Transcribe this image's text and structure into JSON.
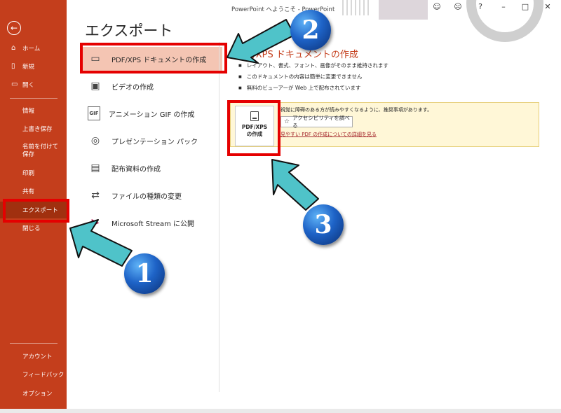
{
  "window": {
    "title": "PowerPoint へようこそ  -  PowerPoint"
  },
  "sidebar": {
    "back_icon": "back-arrow-icon",
    "top_items": [
      {
        "label": "ホーム",
        "icon": "home-icon"
      },
      {
        "label": "新規",
        "icon": "new-document-icon"
      },
      {
        "label": "開く",
        "icon": "open-folder-icon"
      }
    ],
    "mid_items": [
      {
        "label": "情報"
      },
      {
        "label": "上書き保存"
      },
      {
        "label": "名前を付けて保存"
      },
      {
        "label": "印刷"
      },
      {
        "label": "共有"
      },
      {
        "label": "エクスポート",
        "active": true
      },
      {
        "label": "閉じる"
      }
    ],
    "bottom_items": [
      {
        "label": "アカウント"
      },
      {
        "label": "フィードバック"
      },
      {
        "label": "オプション"
      }
    ]
  },
  "main": {
    "title": "エクスポート",
    "options": [
      {
        "label": "PDF/XPS ドキュメントの作成",
        "icon": "pdf-document-icon",
        "selected": true
      },
      {
        "label": "ビデオの作成",
        "icon": "video-icon"
      },
      {
        "label": "アニメーション GIF の作成",
        "icon": "gif-icon"
      },
      {
        "label": "プレゼンテーション パック",
        "icon": "package-icon"
      },
      {
        "label": "配布資料の作成",
        "icon": "handout-icon"
      },
      {
        "label": "ファイルの種類の変更",
        "icon": "file-type-icon"
      },
      {
        "label": "Microsoft Stream に公開",
        "icon": "stream-icon"
      }
    ]
  },
  "detail": {
    "title": "PDF/XPS ドキュメントの作成",
    "bullets": [
      "レイアウト、書式、フォント、画像がそのまま維持されます",
      "このドキュメントの内容は簡単に変更できません",
      "無料のビューアーが Web 上で配布されています"
    ],
    "pdf_button": {
      "line1": "PDF/XPS",
      "line2": "の作成"
    },
    "accessibility_warning": "視覚に障碍のある方が読みやすくなるように、推奨事項があります。",
    "accessibility_button": "アクセシビリティを調べる",
    "learn_more_link": "見やすい PDF の作成についての詳細を見る"
  },
  "overlay": {
    "badges": [
      "1",
      "2",
      "3"
    ],
    "colors": {
      "highlight": "#e50000",
      "arrow": "#4fc3c9",
      "badge": "#1e63c7"
    }
  },
  "theme": {
    "accent": "#c43e1c",
    "selected_bg": "#f4c5b3",
    "info_bg": "#fff7d7"
  }
}
